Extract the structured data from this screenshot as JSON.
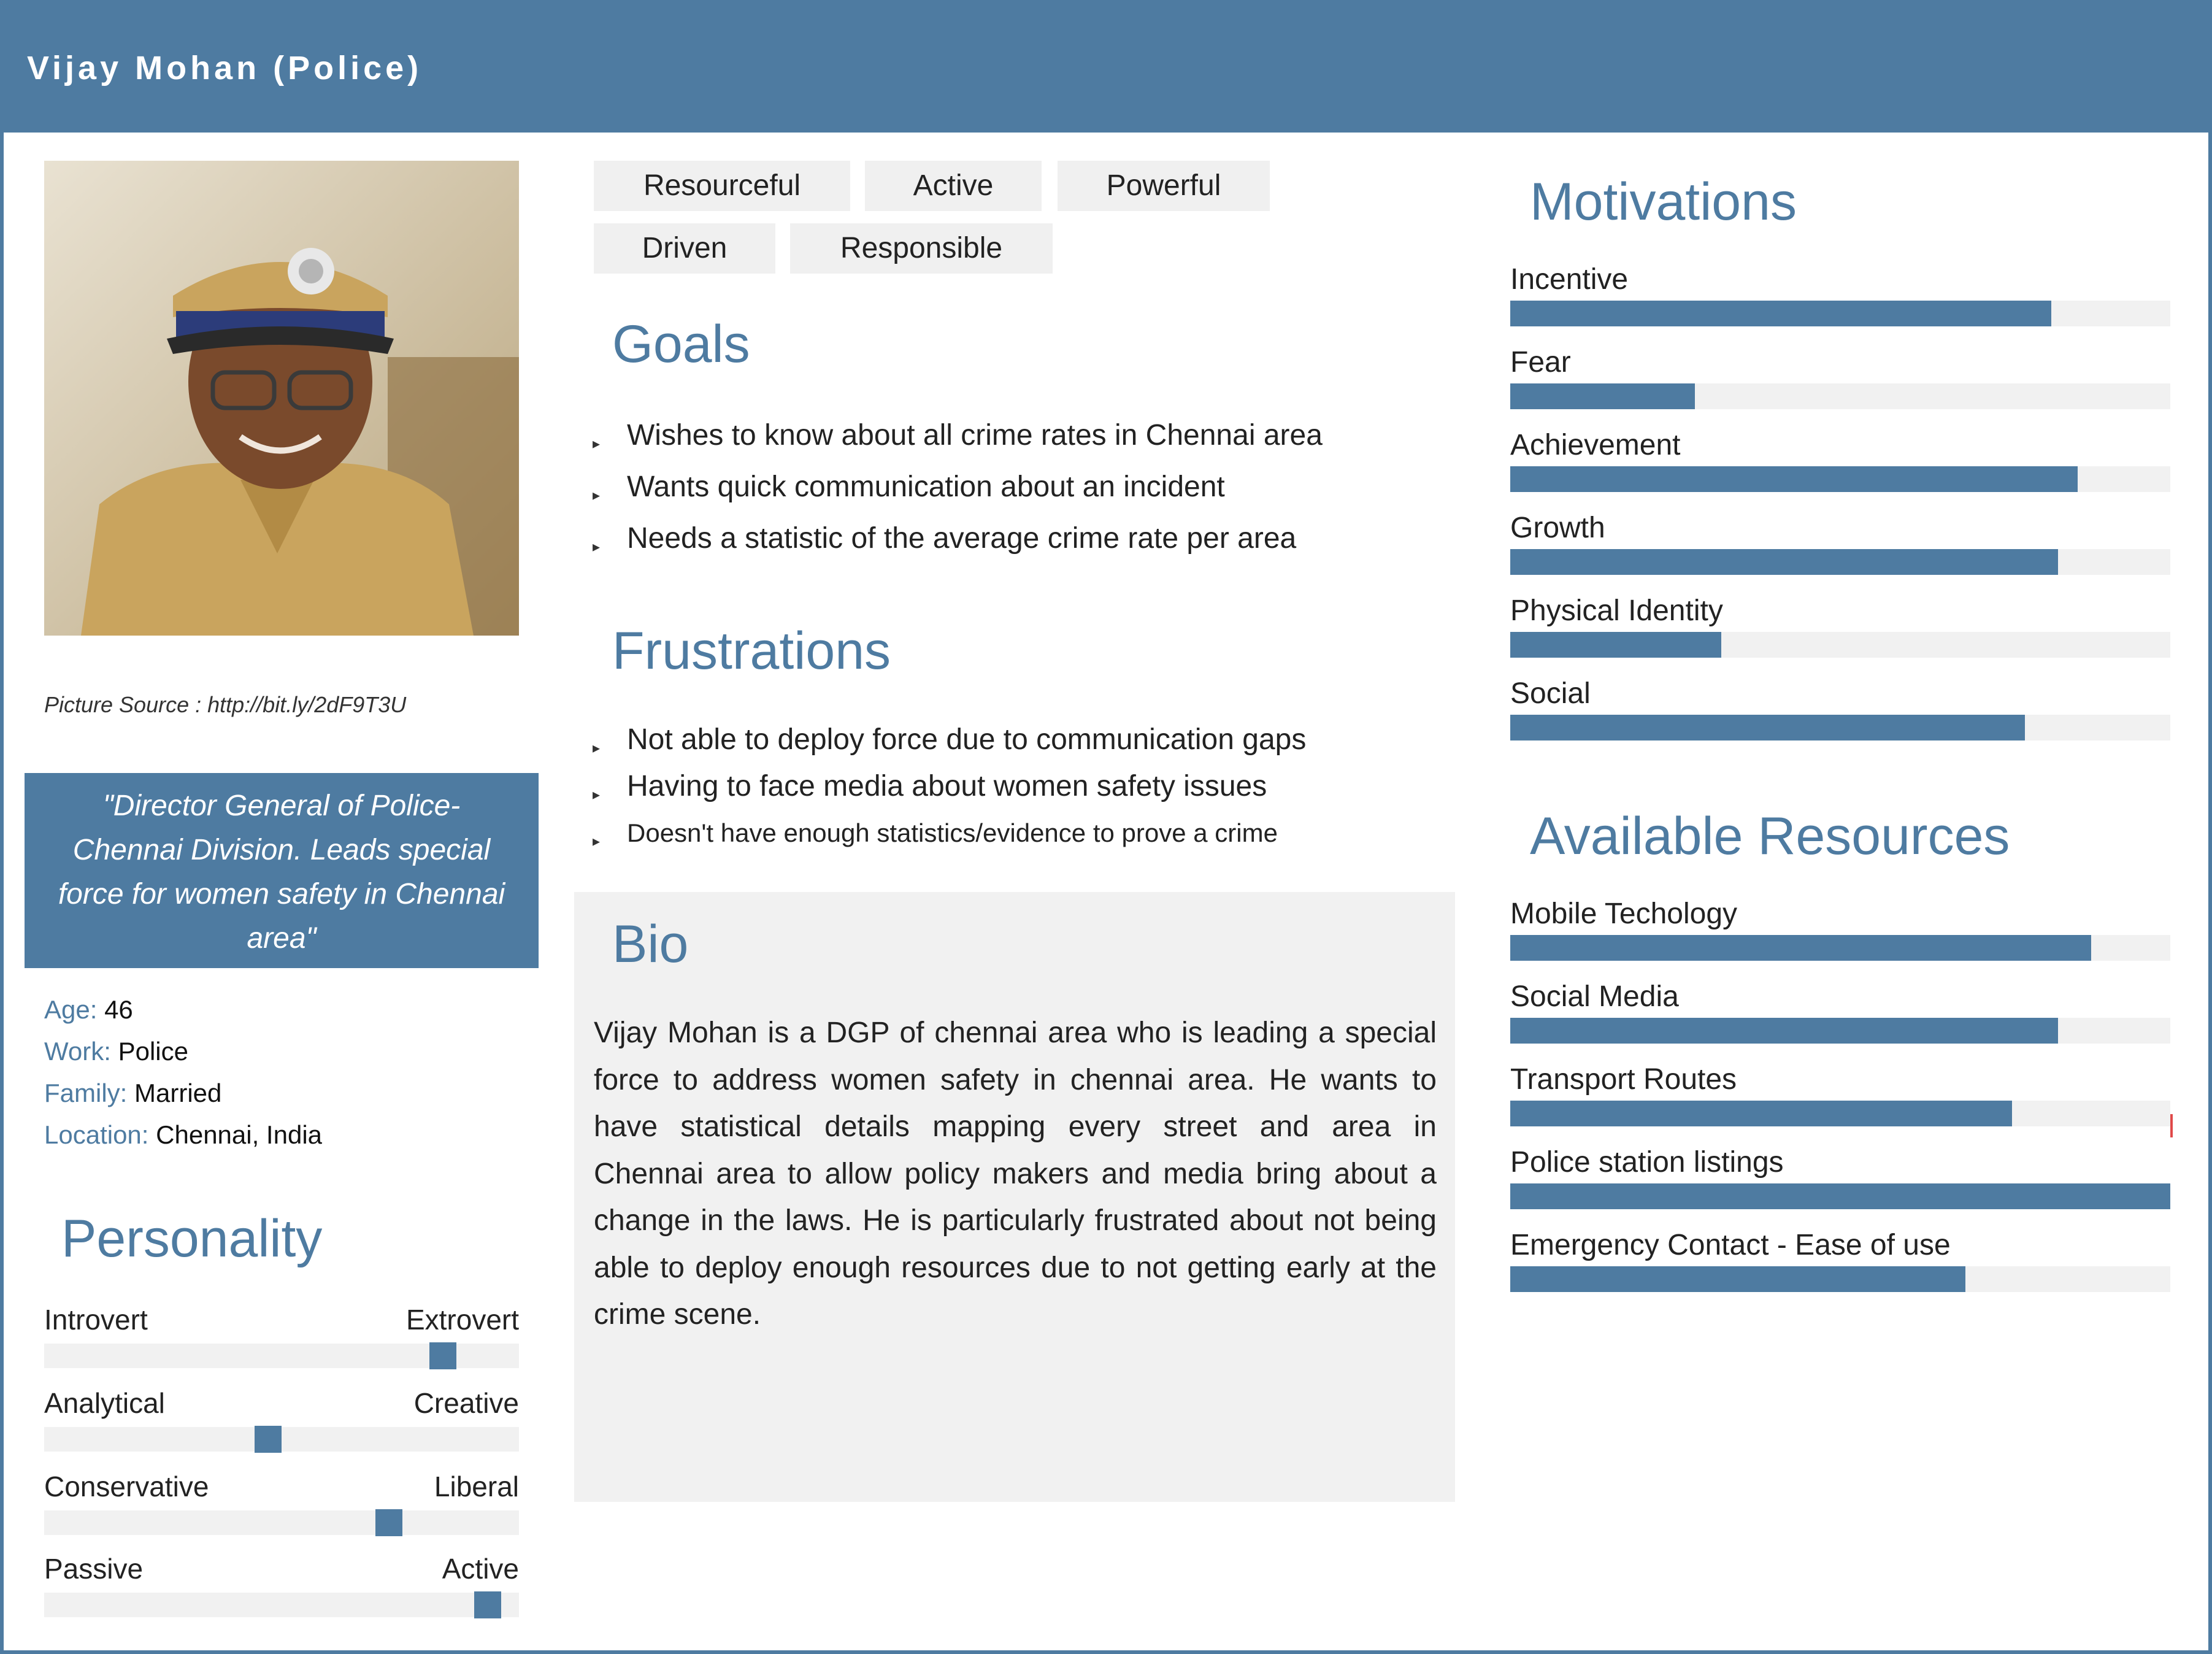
{
  "header": {
    "title": "Vijay Mohan (Police)"
  },
  "photo": {
    "picture_source": "Picture Source : http://bit.ly/2dF9T3U"
  },
  "quote": "\"Director General of Police-Chennai Division. Leads special force for women safety in Chennai area\"",
  "details": [
    {
      "label": "Age:",
      "value": "46"
    },
    {
      "label": "Work:",
      "value": "Police"
    },
    {
      "label": "Family:",
      "value": "Married"
    },
    {
      "label": "Location:",
      "value": "Chennai, India"
    }
  ],
  "personality": {
    "title": "Personality",
    "traits": [
      {
        "left": "Introvert",
        "right": "Extrovert",
        "level": 0.86
      },
      {
        "left": "Analytical",
        "right": "Creative",
        "level": 0.47
      },
      {
        "left": "Conservative",
        "right": "Liberal",
        "level": 0.74
      },
      {
        "left": "Passive",
        "right": "Active",
        "level": 0.96
      }
    ]
  },
  "tags": [
    "Resourceful",
    "Active",
    "Powerful",
    "Driven",
    "Responsible"
  ],
  "goals": {
    "title": "Goals",
    "items": [
      "Wishes to know about all crime rates in Chennai area",
      "Wants quick communication about an incident",
      "Needs a statistic of the average crime rate per area"
    ]
  },
  "frustrations": {
    "title": "Frustrations",
    "items": [
      "Not able to deploy force due to communication gaps",
      "Having to face media about women safety issues",
      "Doesn't have enough statistics/evidence to prove a crime"
    ]
  },
  "bio": {
    "title": "Bio",
    "text": "Vijay Mohan is a DGP of chennai area who is leading a special force to address women safety in chennai area. He wants to have statistical details mapping every street and area in Chennai area to allow policy makers and media bring about a change in the laws. He is particularly frustrated about not being able to deploy enough resources due to not getting early at the crime scene."
  },
  "motivations": {
    "title": "Motivations",
    "items": [
      {
        "label": "Incentive",
        "value": 0.82
      },
      {
        "label": "Fear",
        "value": 0.28
      },
      {
        "label": "Achievement",
        "value": 0.86
      },
      {
        "label": "Growth",
        "value": 0.83
      },
      {
        "label": "Physical Identity",
        "value": 0.32
      },
      {
        "label": "Social",
        "value": 0.78
      }
    ]
  },
  "resources": {
    "title": "Available Resources",
    "items": [
      {
        "label": "Mobile Techology",
        "value": 0.88
      },
      {
        "label": "Social Media",
        "value": 0.83
      },
      {
        "label": "Transport Routes",
        "value": 0.76
      },
      {
        "label": "Police station listings",
        "value": 1.0
      },
      {
        "label": "Emergency Contact - Ease of use",
        "value": 0.69
      }
    ]
  },
  "colors": {
    "accent": "#4e7ba1",
    "track": "#f1f1f1",
    "tag_bg": "#f0f0f0",
    "marker": "#e04a4a"
  }
}
